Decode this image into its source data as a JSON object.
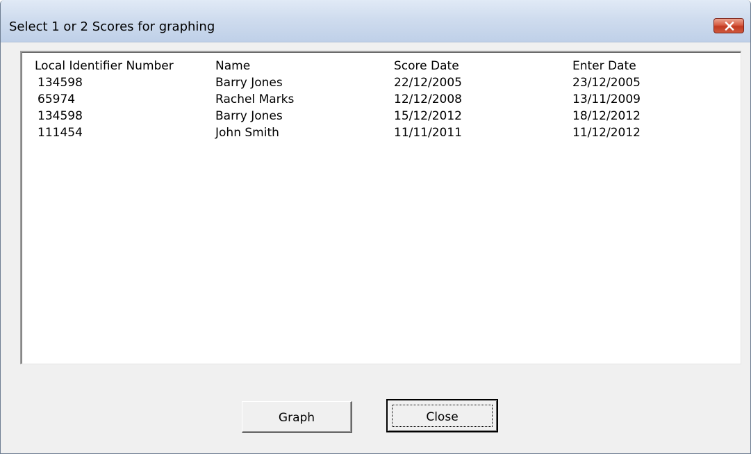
{
  "window": {
    "title": "Select 1 or 2 Scores for graphing",
    "close_icon": "close-x-icon"
  },
  "list": {
    "headers": [
      "Local Identifier Number",
      "Name",
      "Score Date",
      "Enter Date"
    ],
    "rows": [
      [
        "134598",
        "Barry Jones",
        "22/12/2005",
        "23/12/2005"
      ],
      [
        "65974",
        "Rachel Marks",
        "12/12/2008",
        "13/11/2009"
      ],
      [
        "134598",
        "Barry Jones",
        "15/12/2012",
        "18/12/2012"
      ],
      [
        "111454",
        "John Smith",
        "11/11/2011",
        "11/12/2012"
      ]
    ]
  },
  "buttons": {
    "graph_label": "Graph",
    "close_label": "Close"
  },
  "colors": {
    "titlebar": "#cfdcee",
    "close_button": "#c13a21",
    "dialog_bg": "#f0f0f0"
  }
}
